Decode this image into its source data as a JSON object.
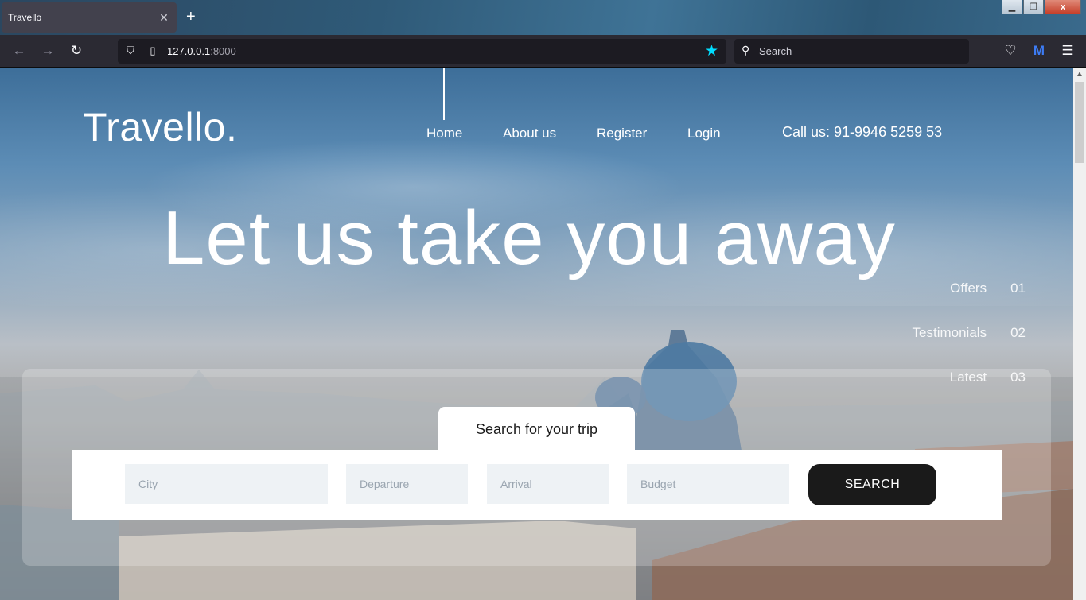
{
  "browser": {
    "tab_title": "Travello",
    "tab_close": "✕",
    "new_tab": "+",
    "url_host": "127.0.0.1",
    "url_port": ":8000",
    "search_placeholder": "Search",
    "window_close": "x"
  },
  "site": {
    "logo": "Travello.",
    "nav": [
      "Home",
      "About us",
      "Register",
      "Login"
    ],
    "call_us": "Call us: 91-9946 5259 53",
    "hero_title": "Let us take you away",
    "side_list": [
      {
        "label": "Offers",
        "num": "01"
      },
      {
        "label": "Testimonials",
        "num": "02"
      },
      {
        "label": "Latest",
        "num": "03"
      }
    ],
    "search_tab": "Search for your trip",
    "fields": {
      "city": "City",
      "departure": "Departure",
      "arrival": "Arrival",
      "budget": "Budget"
    },
    "search_button": "SEARCH"
  }
}
